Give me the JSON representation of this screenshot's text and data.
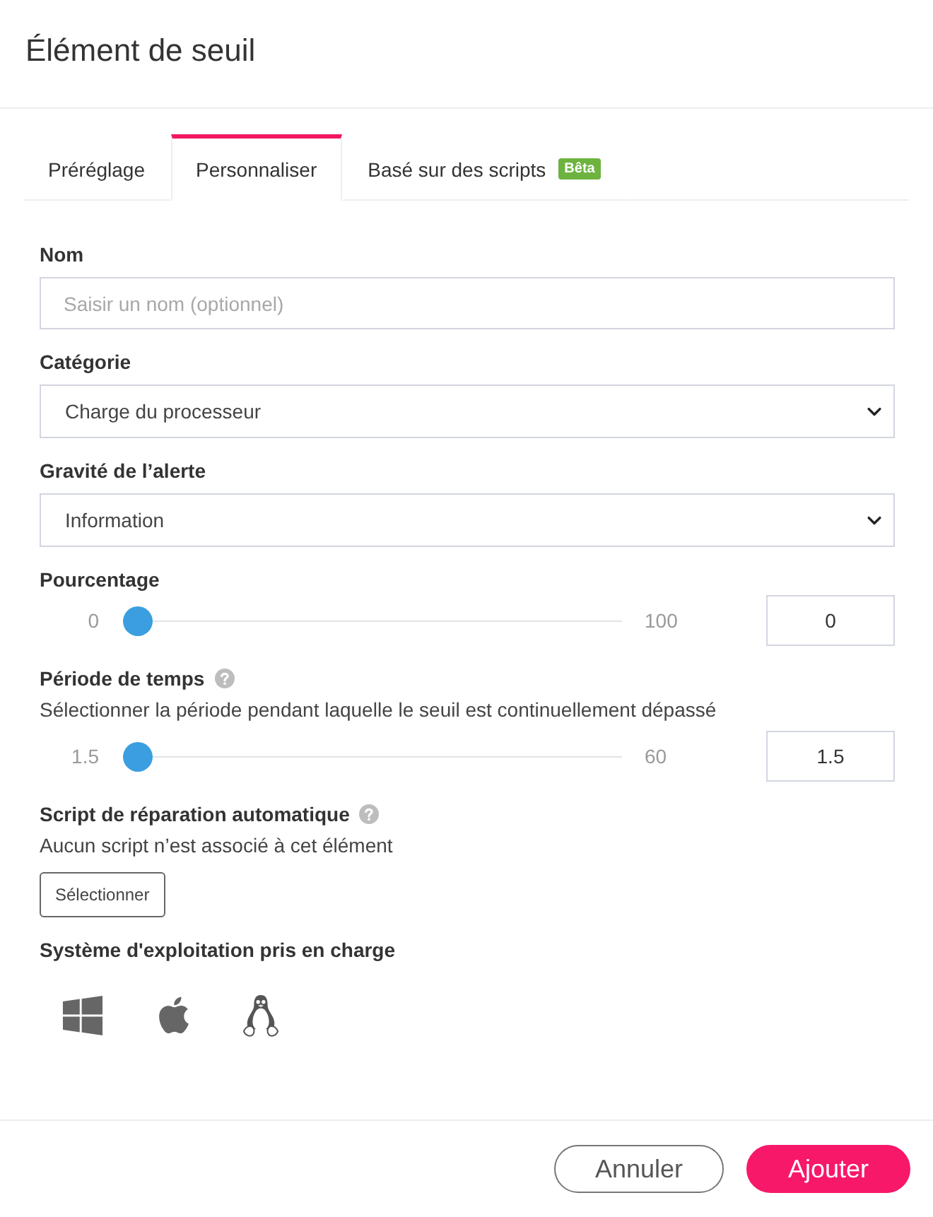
{
  "title": "Élément de seuil",
  "tabs": [
    {
      "label": "Préréglage",
      "selected": false
    },
    {
      "label": "Personnaliser",
      "selected": true
    },
    {
      "label": "Basé sur des scripts",
      "selected": false,
      "badge": "Bêta"
    }
  ],
  "fields": [
    {
      "kind": "text",
      "label": "Nom",
      "placeholder": "Saisir un nom (optionnel)"
    },
    {
      "kind": "select",
      "label": "Catégorie",
      "value": "Charge du processeur"
    },
    {
      "kind": "select",
      "label": "Gravité de l’alerte",
      "value": "Information"
    },
    {
      "kind": "slider",
      "label": "Pourcentage",
      "min": "0",
      "max": "100",
      "level": 0,
      "value": "0"
    },
    {
      "kind": "slider",
      "label": "Période de temps",
      "help": true,
      "description": "Sélectionner la période pendant laquelle le seuil est continuellement dépassé",
      "min": "1.5",
      "max": "60",
      "level": 0,
      "value": "1.5"
    },
    {
      "kind": "script",
      "label": "Script de réparation automatique",
      "help": true,
      "description": "Aucun script n’est associé à cet élément",
      "button": "Sélectionner"
    },
    {
      "kind": "os",
      "label": "Système d'exploitation pris en charge",
      "systems": [
        {
          "kind": "windows"
        },
        {
          "kind": "apple"
        },
        {
          "kind": "linux"
        }
      ]
    }
  ],
  "buttons": [
    {
      "label": "Annuler",
      "kind": "secondary"
    },
    {
      "label": "Ajouter",
      "kind": "primary"
    }
  ]
}
